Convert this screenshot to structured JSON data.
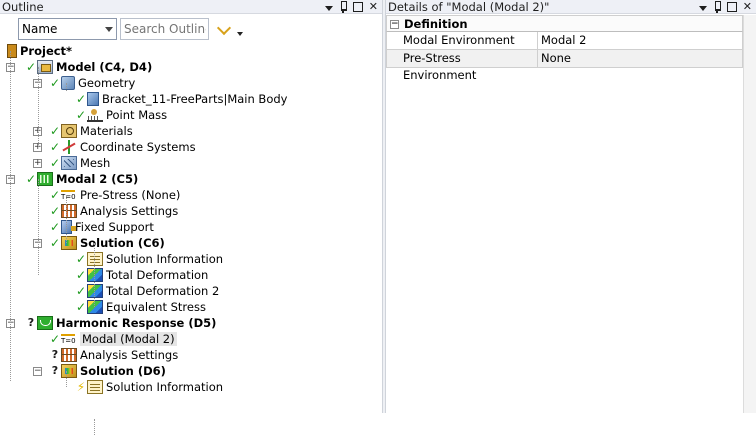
{
  "outline": {
    "title": "Outline",
    "name_filter": "Name",
    "search_placeholder": "Search Outline",
    "tree": [
      {
        "label": "Project*",
        "bold": true
      },
      {
        "label": "Model (C4, D4)",
        "bold": true
      },
      {
        "label": "Geometry"
      },
      {
        "label": "Bracket_11-FreeParts|Main Body"
      },
      {
        "label": "Point Mass"
      },
      {
        "label": "Materials"
      },
      {
        "label": "Coordinate Systems"
      },
      {
        "label": "Mesh"
      },
      {
        "label": "Modal 2 (C5)",
        "bold": true
      },
      {
        "label": "Pre-Stress (None)"
      },
      {
        "label": "Analysis Settings"
      },
      {
        "label": "Fixed Support"
      },
      {
        "label": "Solution (C6)",
        "bold": true
      },
      {
        "label": "Solution Information"
      },
      {
        "label": "Total Deformation"
      },
      {
        "label": "Total Deformation 2"
      },
      {
        "label": "Equivalent Stress"
      },
      {
        "label": "Harmonic Response (D5)",
        "bold": true
      },
      {
        "label": "Modal (Modal 2)"
      },
      {
        "label": "Analysis Settings"
      },
      {
        "label": "Solution (D6)",
        "bold": true
      },
      {
        "label": "Solution Information"
      }
    ]
  },
  "details": {
    "title": "Details of \"Modal (Modal 2)\"",
    "section": "Definition",
    "rows": [
      {
        "name": "Modal Environment",
        "value": "Modal 2"
      },
      {
        "name": "Pre-Stress Environment",
        "value": "None"
      }
    ]
  }
}
